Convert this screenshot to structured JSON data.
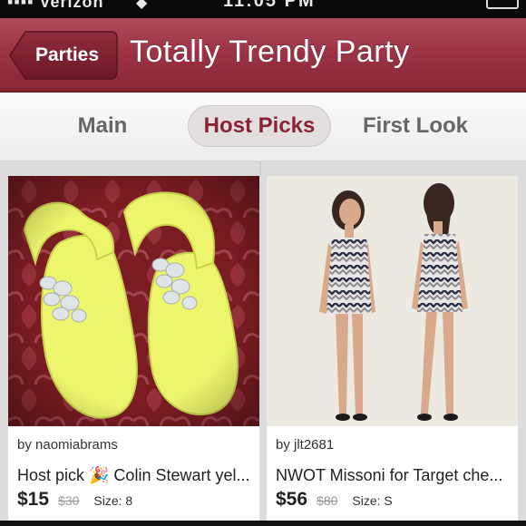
{
  "status_bar": {
    "carrier": "▪▪▪▪ Verizon",
    "wifi_icon": "wifi-icon",
    "time": "11:05 PM",
    "battery_icon": "battery-icon"
  },
  "header": {
    "back_label": "Parties",
    "title": "Totally Trendy Party",
    "color": "#9c3446"
  },
  "tabs": [
    {
      "label": "Main",
      "active": false
    },
    {
      "label": "Host Picks",
      "active": true
    },
    {
      "label": "First Look",
      "active": false
    }
  ],
  "listings": [
    {
      "seller": "by naomiabrams",
      "title": "Host pick 🎉 Colin Stewart yel...",
      "price": "$15",
      "original_price": "$30",
      "size": "Size: 8",
      "image_icon": "yellow-sandals-photo"
    },
    {
      "seller": "by jlt2681",
      "title": "NWOT Missoni for Target che...",
      "price": "$56",
      "original_price": "$80",
      "size": "Size: S",
      "image_icon": "chevron-dress-photo"
    }
  ]
}
